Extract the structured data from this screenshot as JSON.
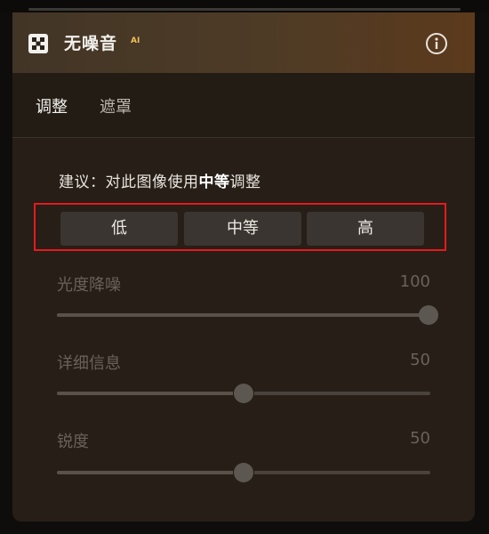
{
  "panel": {
    "title": "无噪音",
    "ai_badge": "AI",
    "icons": {
      "logo": "noise-logo-icon",
      "info": "info-icon"
    }
  },
  "tabs": [
    {
      "label": "调整",
      "active": true
    },
    {
      "label": "遮罩",
      "active": false
    }
  ],
  "suggestion": {
    "prefix": "建议：对此图像使用",
    "highlight": "中等",
    "suffix": "调整"
  },
  "segmented": {
    "options": [
      "低",
      "中等",
      "高"
    ],
    "highlight_color": "#e8191d"
  },
  "sliders": [
    {
      "label": "光度降噪",
      "value": "100",
      "level": 1.0
    },
    {
      "label": "详细信息",
      "value": "50",
      "level": 0.5
    },
    {
      "label": "锐度",
      "value": "50",
      "level": 0.5
    }
  ],
  "colors": {
    "accent_ai": "#f0c15a",
    "panel_bg": "#261e17"
  }
}
